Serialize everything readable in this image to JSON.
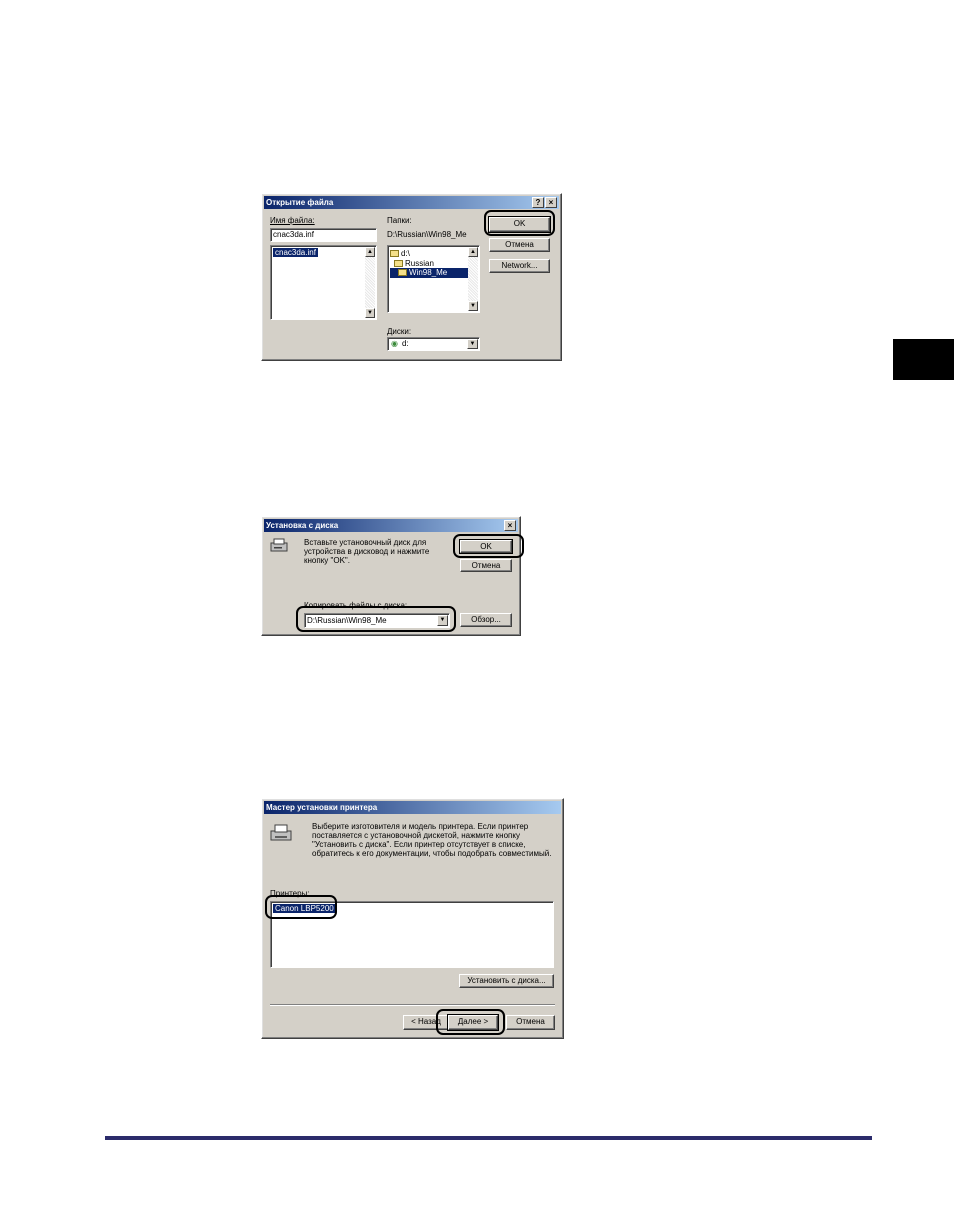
{
  "dialog_open_file": {
    "title": "Открытие файла",
    "help_btn": "?",
    "close_btn": "×",
    "filename_label": "Имя файла:",
    "filename_value": "cnac3da.inf",
    "file_list": [
      "cnac3da.inf"
    ],
    "folders_label": "Папки:",
    "folder_path": "D:\\Russian\\Win98_Me",
    "folder_tree": [
      "d:\\",
      "Russian",
      "Win98_Me"
    ],
    "drives_label": "Диски:",
    "drive_value": "d:",
    "ok_label": "OK",
    "cancel_label": "Отмена",
    "network_label": "Network..."
  },
  "dialog_install_disk": {
    "title": "Установка с диска",
    "close_btn": "×",
    "message": "Вставьте установочный диск для устройства в дисковод и нажмите кнопку \"OK\".",
    "copy_label": "Копировать файлы с диска:",
    "path_value": "D:\\Russian\\Win98_Me",
    "ok_label": "OK",
    "cancel_label": "Отмена",
    "browse_label": "Обзор..."
  },
  "dialog_printer_wizard": {
    "title": "Мастер установки принтера",
    "message": "Выберите изготовителя и модель принтера. Если принтер поставляется с установочной дискетой, нажмите кнопку \"Установить с диска\". Если принтер отсутствует в списке, обратитесь к его документации, чтобы подобрать совместимый.",
    "list_label": "Принтеры:",
    "printers": [
      "Canon LBP5200"
    ],
    "have_disk_label": "Установить с диска...",
    "back_label": "< Назад",
    "next_label": "Далее >",
    "cancel_label": "Отмена"
  }
}
